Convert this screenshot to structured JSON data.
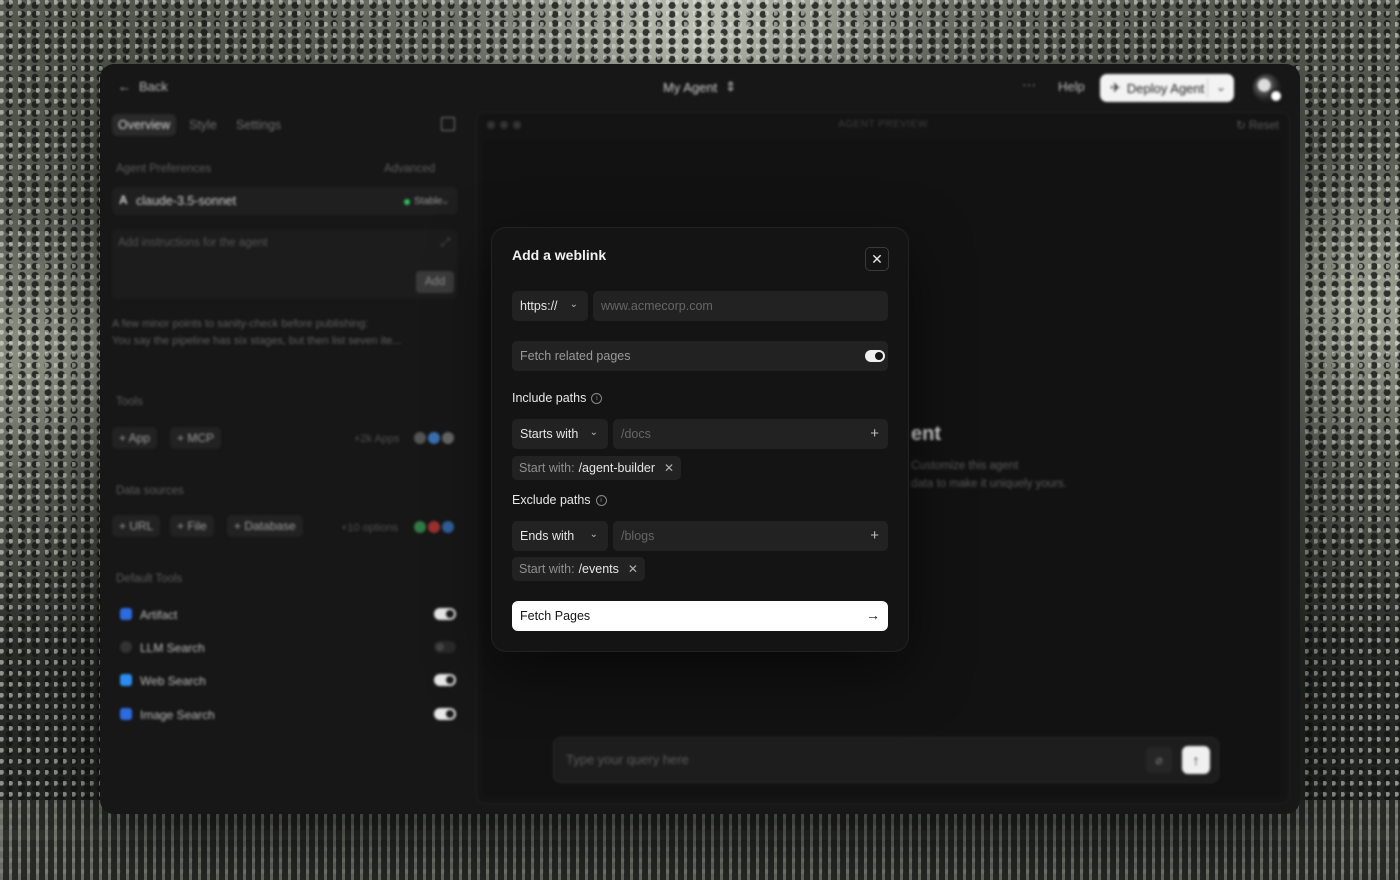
{
  "header": {
    "back_label": "Back",
    "agent_title": "My Agent",
    "more_label": "···",
    "help_label": "Help",
    "deploy_label": "Deploy Agent"
  },
  "left_panel": {
    "tabs": [
      "Overview",
      "Style",
      "Settings"
    ],
    "preferences_label": "Agent Preferences",
    "advanced_label": "Advanced",
    "model_name": "claude-3.5-sonnet",
    "model_status": "Stable",
    "instructions_placeholder": "Add instructions for the agent",
    "add_label": "Add",
    "note_line1": "A few minor points to sanity-check before publishing:",
    "note_line2": "You say the pipeline has six stages, but then list seven ite...",
    "tools_label": "Tools",
    "tool_chips": [
      "+ App",
      "+ MCP"
    ],
    "apps_count": "+2k Apps",
    "data_sources_label": "Data sources",
    "source_chips": [
      "+ URL",
      "+ File",
      "+ Database"
    ],
    "options_count": "+10 options",
    "default_tools_label": "Default Tools",
    "default_tools": [
      {
        "name": "Artifact",
        "enabled": true,
        "color": "#2d6cdf"
      },
      {
        "name": "LLM Search",
        "enabled": false,
        "color": "#444444"
      },
      {
        "name": "Web Search",
        "enabled": true,
        "color": "#2d8cf0"
      },
      {
        "name": "Image Search",
        "enabled": true,
        "color": "#2d6cdf"
      }
    ]
  },
  "preview": {
    "label": "AGENT PREVIEW",
    "reset_label": "Reset",
    "hero_title_fragment": "ent",
    "hero_sub_line1": "Customize this agent",
    "hero_sub_line2": "data to make it uniquely yours.",
    "query_placeholder": "Type your query here"
  },
  "modal": {
    "title": "Add a weblink",
    "protocol": "https://",
    "url_placeholder": "www.acmecorp.com",
    "fetch_related_label": "Fetch related pages",
    "fetch_related_enabled": true,
    "include_label": "Include paths",
    "include_match": "Starts with",
    "include_placeholder": "/docs",
    "include_tag_key": "Start with:",
    "include_tag_value": "/agent-builder",
    "exclude_label": "Exclude paths",
    "exclude_match": "Ends with",
    "exclude_placeholder": "/blogs",
    "exclude_tag_key": "Start with:",
    "exclude_tag_value": "/events",
    "submit_label": "Fetch Pages"
  }
}
